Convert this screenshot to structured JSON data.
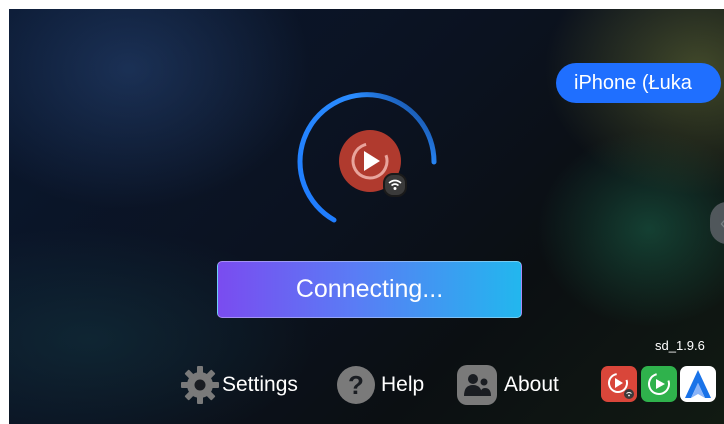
{
  "device": {
    "name": "iPhone (Łuka"
  },
  "status": {
    "button_label": "Connecting..."
  },
  "nav": {
    "settings_label": "Settings",
    "help_label": "Help",
    "about_label": "About"
  },
  "version": "sd_1.9.6",
  "apps": [
    "carplay-wireless",
    "carplay",
    "android-auto"
  ],
  "colors": {
    "accent": "#1f6fff",
    "carplay_red": "#d9463a",
    "carplay_green": "#2fb24c",
    "android_auto_blue": "#1a73e8",
    "spinner": "#1e7bff"
  }
}
